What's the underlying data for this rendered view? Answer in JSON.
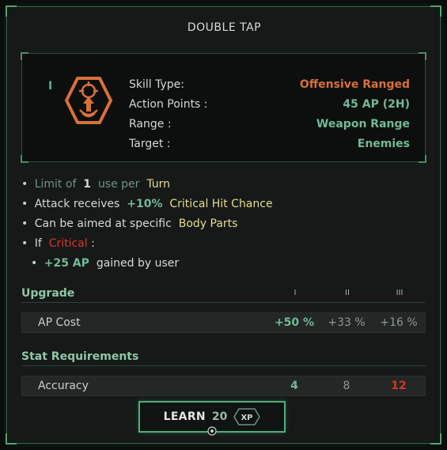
{
  "title": "DOUBLE TAP",
  "tier_mark": "I",
  "icons": {
    "skill": "skill-target-arrow-icon",
    "xp": "xp-badge-icon",
    "button_prompt": "gamepad-button-icon"
  },
  "stats": [
    {
      "key": "Skill Type:",
      "value": "Offensive Ranged",
      "color": "#d9703a"
    },
    {
      "key": "Action Points :",
      "value": "45 AP  (2H)",
      "color": "#74b896"
    },
    {
      "key": "Range :",
      "value": "Weapon Range",
      "color": "#74b896"
    },
    {
      "key": "Target :",
      "value": "Enemies",
      "color": "#74b896"
    }
  ],
  "description": {
    "line1": {
      "a": "Limit of",
      "b": "1",
      "c": "use per",
      "d": "Turn"
    },
    "line2": {
      "a": "Attack receives",
      "b": "+10%",
      "c": "Critical Hit Chance"
    },
    "line3": {
      "a": "Can be aimed at specific",
      "b": "Body Parts"
    },
    "line4": {
      "a": "If",
      "b": "Critical",
      "c": ":"
    },
    "line5": {
      "a": "+25 AP",
      "b": "gained by user"
    }
  },
  "upgrade": {
    "header": "Upgrade",
    "tiers": [
      "I",
      "II",
      "III"
    ],
    "rows": [
      {
        "label": "AP Cost",
        "values": [
          "+50 %",
          "+33 %",
          "+16 %"
        ]
      }
    ]
  },
  "requirements": {
    "header": "Stat Requirements",
    "rows": [
      {
        "label": "Accuracy",
        "values": [
          "4",
          "8",
          "12"
        ]
      }
    ]
  },
  "learn_button": {
    "label": "LEARN",
    "cost": "20",
    "unit": "XP"
  },
  "colors": {
    "accent_green": "#74b896",
    "orange": "#d9703a",
    "red": "#d8352c",
    "yellow": "#e6dc8e",
    "border": "#4fae7b"
  }
}
